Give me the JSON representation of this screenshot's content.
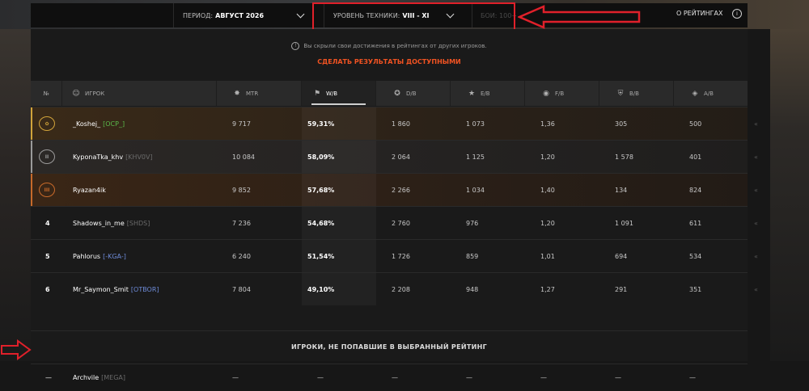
{
  "filters": {
    "period_label": "ПЕРИОД:",
    "period_value": "АВГУСТ 2026",
    "tier_label": "УРОВЕНЬ ТЕХНИКИ:",
    "tier_value": "VIII - XI",
    "battles_placeholder": "БОИ: 100+",
    "about_label": "О РЕЙТИНГАХ",
    "info_icon": "info-icon"
  },
  "notice": {
    "text": "Вы скрыли свои достижения в рейтингах от других игроков.",
    "link": "СДЕЛАТЬ РЕЗУЛЬТАТЫ ДОСТУПНЫМИ"
  },
  "columns": [
    {
      "key": "num",
      "label": "№",
      "icon": ""
    },
    {
      "key": "player",
      "label": "ИГРОК",
      "icon": "player-icon"
    },
    {
      "key": "mtr",
      "label": "MTR",
      "icon": "mtr-icon"
    },
    {
      "key": "wb",
      "label": "W/B",
      "icon": "flag-icon"
    },
    {
      "key": "db",
      "label": "D/B",
      "icon": "damage-icon"
    },
    {
      "key": "eb",
      "label": "E/B",
      "icon": "experience-icon"
    },
    {
      "key": "fb",
      "label": "F/B",
      "icon": "frags-icon"
    },
    {
      "key": "bb",
      "label": "B/B",
      "icon": "blocked-icon"
    },
    {
      "key": "ab",
      "label": "A/B",
      "icon": "assist-icon"
    }
  ],
  "rows": [
    {
      "rank": "1",
      "medal": "gold",
      "name": "_Koshej_",
      "clan": "[OCP_]",
      "clan_color": "#59b84a",
      "mtr": "9 717",
      "wb": "59,31%",
      "db": "1 860",
      "eb": "1 073",
      "fb": "1,36",
      "bb": "305",
      "ab": "500"
    },
    {
      "rank": "2",
      "medal": "silver",
      "name": "KyponaTka_khv",
      "clan": "[KHV0V]",
      "clan_color": "#6a6a6a",
      "mtr": "10 084",
      "wb": "58,09%",
      "db": "2 064",
      "eb": "1 125",
      "fb": "1,20",
      "bb": "1 578",
      "ab": "401"
    },
    {
      "rank": "3",
      "medal": "bronze",
      "name": "Ryazan4ik",
      "clan": "",
      "clan_color": "#6a6a6a",
      "mtr": "9 852",
      "wb": "57,68%",
      "db": "2 266",
      "eb": "1 034",
      "fb": "1,40",
      "bb": "134",
      "ab": "824"
    },
    {
      "rank": "4",
      "medal": "",
      "name": "Shadows_in_me",
      "clan": "[SHDS]",
      "clan_color": "#6a6a6a",
      "mtr": "7 236",
      "wb": "54,68%",
      "db": "2 760",
      "eb": "976",
      "fb": "1,20",
      "bb": "1 091",
      "ab": "611"
    },
    {
      "rank": "5",
      "medal": "",
      "name": "Pahlorus",
      "clan": "[-KGA-]",
      "clan_color": "#6e8bd8",
      "mtr": "6 240",
      "wb": "51,54%",
      "db": "1 726",
      "eb": "859",
      "fb": "1,01",
      "bb": "694",
      "ab": "534"
    },
    {
      "rank": "6",
      "medal": "",
      "name": "Mr_Saymon_Smit",
      "clan": "[OTBOR]",
      "clan_color": "#6e8bd8",
      "mtr": "7 804",
      "wb": "49,10%",
      "db": "2 208",
      "eb": "948",
      "fb": "1,27",
      "bb": "291",
      "ab": "351"
    }
  ],
  "section_title": "ИГРОКИ, НЕ ПОПАВШИЕ В ВЫБРАННЫЙ РЕЙТИНГ",
  "unranked": {
    "rank": "—",
    "name": "Archvile",
    "clan": "[MEGA]",
    "dash": "—"
  },
  "colors": {
    "accent": "#f25322",
    "highlight": "#e0202a",
    "gold": "#d1a33a",
    "silver": "#9a9a9a",
    "bronze": "#c76a2a"
  }
}
